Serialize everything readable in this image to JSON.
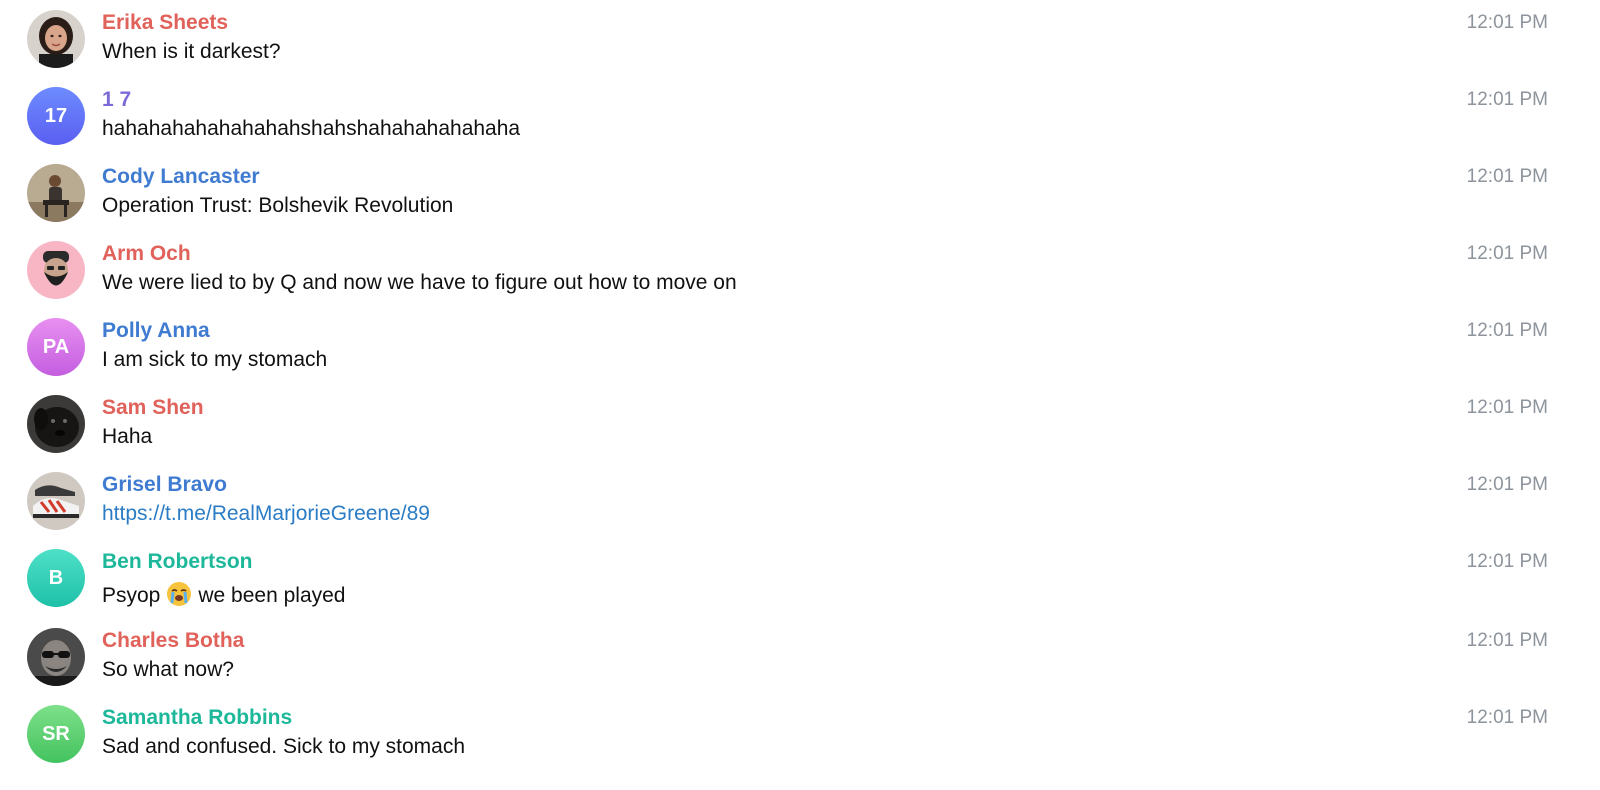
{
  "messages": [
    {
      "sender": "Erika Sheets",
      "sender_color": "#e0625a",
      "text": "When is it darkest?",
      "time": "12:01 PM",
      "avatar": {
        "type": "photo",
        "icon": "woman-portrait-photo"
      }
    },
    {
      "sender": "1 7",
      "sender_color": "#7b6bd6",
      "text": "hahahahahahahahahshahshahahahahahaha",
      "time": "12:01 PM",
      "avatar": {
        "type": "initials",
        "initials": "17",
        "color_top": "#6e8cff",
        "color_bottom": "#5a5ef0"
      }
    },
    {
      "sender": "Cody Lancaster",
      "sender_color": "#3f7bd0",
      "text": "Operation Trust: Bolshevik Revolution",
      "time": "12:01 PM",
      "avatar": {
        "type": "photo",
        "icon": "man-sitting-photo"
      }
    },
    {
      "sender": "Arm Och",
      "sender_color": "#e0625a",
      "text": "We were lied to by Q and now we have to figure out how to move on",
      "time": "12:01 PM",
      "avatar": {
        "type": "photo",
        "icon": "cartoon-bearded-man-avatar"
      }
    },
    {
      "sender": "Polly Anna",
      "sender_color": "#3f7bd0",
      "text": "I am sick to my stomach",
      "time": "12:01 PM",
      "avatar": {
        "type": "initials",
        "initials": "PA",
        "color_top": "#e890f0",
        "color_bottom": "#c45ee0"
      }
    },
    {
      "sender": "Sam Shen",
      "sender_color": "#e0625a",
      "text": "Haha",
      "time": "12:01 PM",
      "avatar": {
        "type": "photo",
        "icon": "black-dog-photo"
      }
    },
    {
      "sender": "Grisel Bravo",
      "sender_color": "#3f7bd0",
      "text": "https://t.me/RealMarjorieGreene/89",
      "is_link": true,
      "time": "12:01 PM",
      "avatar": {
        "type": "photo",
        "icon": "sneakers-photo"
      }
    },
    {
      "sender": "Ben Robertson",
      "sender_color": "#1db89a",
      "text_before": "Psyop",
      "emoji": "loudly-crying-face-emoji",
      "text_after": "we been played",
      "time": "12:01 PM",
      "avatar": {
        "type": "initials",
        "initials": "B",
        "color_top": "#4fe0c8",
        "color_bottom": "#1ec0a8"
      }
    },
    {
      "sender": "Charles Botha",
      "sender_color": "#e0625a",
      "text": "So what now?",
      "time": "12:01 PM",
      "avatar": {
        "type": "photo",
        "icon": "man-sunglasses-photo"
      }
    },
    {
      "sender": "Samantha Robbins",
      "sender_color": "#1db89a",
      "text": "Sad and confused. Sick to my stomach",
      "time": "12:01 PM",
      "avatar": {
        "type": "initials",
        "initials": "SR",
        "color_top": "#7ee08a",
        "color_bottom": "#43c35f"
      }
    }
  ]
}
